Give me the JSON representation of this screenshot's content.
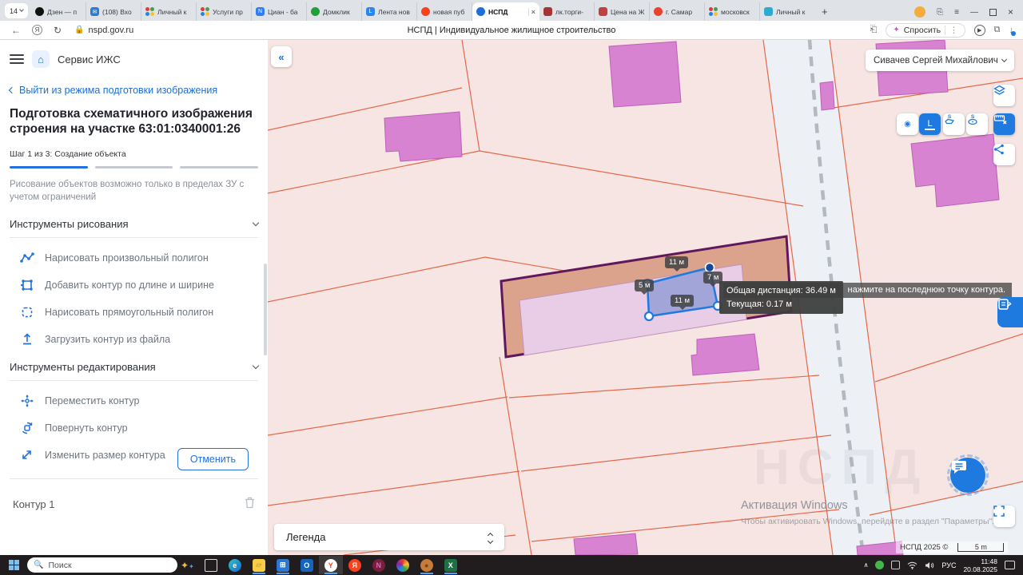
{
  "browser": {
    "tab_count": "14",
    "tabs": [
      "Дзен — п",
      "(108) Вхо",
      "Личный к",
      "Услуги пр",
      "Циан - ба",
      "Домклик",
      "Лента нов",
      "новая пуб",
      "НСПД",
      "лк.торги-",
      "Цена на Ж",
      "г. Самар",
      "московск",
      "Личный к"
    ],
    "url": "nspd.gov.ru",
    "page_title": "НСПД | Индивидуальное жилищное строительство",
    "ask_button": "Спросить"
  },
  "sidebar": {
    "app_title": "Сервис ИЖС",
    "exit_link": "Выйти из режима подготовки изображения",
    "title": "Подготовка схематичного изображения строения на участке 63:01:0340001:26",
    "step_label": "Шаг 1 из 3: Создание объекта",
    "hint": "Рисование объектов возможно только в пределах ЗУ с учетом ограничений",
    "draw_section": "Инструменты рисования",
    "draw_tools": [
      "Нарисовать произвольный полигон",
      "Добавить контур по длине и ширине",
      "Нарисовать прямоугольный полигон",
      "Загрузить контур из файла"
    ],
    "edit_section": "Инструменты редактирования",
    "edit_tools": [
      "Переместить контур",
      "Повернуть контур",
      "Изменить размер контура"
    ],
    "contour_label": "Контур 1",
    "cancel_button": "Отменить"
  },
  "map": {
    "user_name": "Сивачев Сергей Михайлович",
    "legend_label": "Легенда",
    "measure_labels": {
      "top": "11 м",
      "right": "7 м",
      "middle": "11 м",
      "left": "5 м"
    },
    "tooltip": {
      "total": "Общая дистанция: 36.49 м",
      "current": "Текущая: 0.17 м",
      "hint": "нажмите на последнюю точку контура."
    },
    "attribution": "НСПД 2025 ©",
    "scale": "5 m",
    "watermark_title": "Активация Windows",
    "watermark_sub": "Чтобы активировать Windows, перейдите в раздел \"Параметры\".",
    "parcel_id": "63:01:0340001:26",
    "colors": {
      "accent_blue": "#1f7ae0",
      "parcel_fill": "#dca38c",
      "parcel_border": "#61175c",
      "building_fill": "#d882d2",
      "line_orange": "#e4684a",
      "map_bg": "#f6e5e3"
    }
  },
  "taskbar": {
    "search_placeholder": "Поиск",
    "lang": "РУС",
    "time": "11:48",
    "date": "20.08.2025",
    "icons": [
      "task-view",
      "edge",
      "file-explorer",
      "store",
      "outlook",
      "yandex-browser",
      "yandex-search",
      "2gis",
      "paint-3d",
      "palette",
      "excel"
    ]
  },
  "icons": {
    "collapse": "«",
    "home": "⌂",
    "back_chevron": "‹",
    "new_tab": "+",
    "close": "×"
  }
}
